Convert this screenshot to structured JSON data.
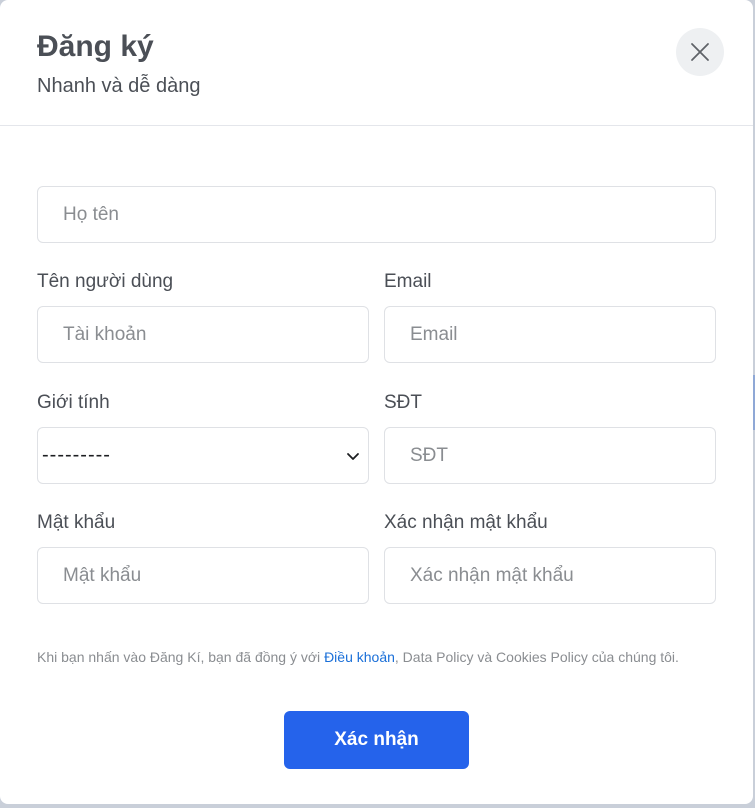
{
  "header": {
    "title": "Đăng ký",
    "subtitle": "Nhanh và dễ dàng",
    "close_icon": "close-icon"
  },
  "form": {
    "full_name": {
      "placeholder": "Họ tên",
      "value": ""
    },
    "username": {
      "label": "Tên người dùng",
      "placeholder": "Tài khoản",
      "value": ""
    },
    "email": {
      "label": "Email",
      "placeholder": "Email",
      "value": ""
    },
    "gender": {
      "label": "Giới tính",
      "selected": "---------",
      "icon": "chevron-down-icon"
    },
    "phone": {
      "label": "SĐT",
      "placeholder": "SĐT",
      "value": ""
    },
    "password": {
      "label": "Mật khẩu",
      "placeholder": "Mật khẩu",
      "value": ""
    },
    "confirm_password": {
      "label": "Xác nhận mật khẩu",
      "placeholder": "Xác nhận mật khẩu",
      "value": ""
    }
  },
  "terms": {
    "prefix": "Khi bạn nhấn vào Đăng Kí, bạn đã đồng ý với ",
    "link": "Điều khoản",
    "suffix": ", Data Policy và Cookies Policy của chúng tôi."
  },
  "submit_label": "Xác nhận",
  "colors": {
    "accent": "#2563eb",
    "link": "#1a6fd8",
    "text": "#4b4f56",
    "placeholder": "#8a8d91"
  }
}
